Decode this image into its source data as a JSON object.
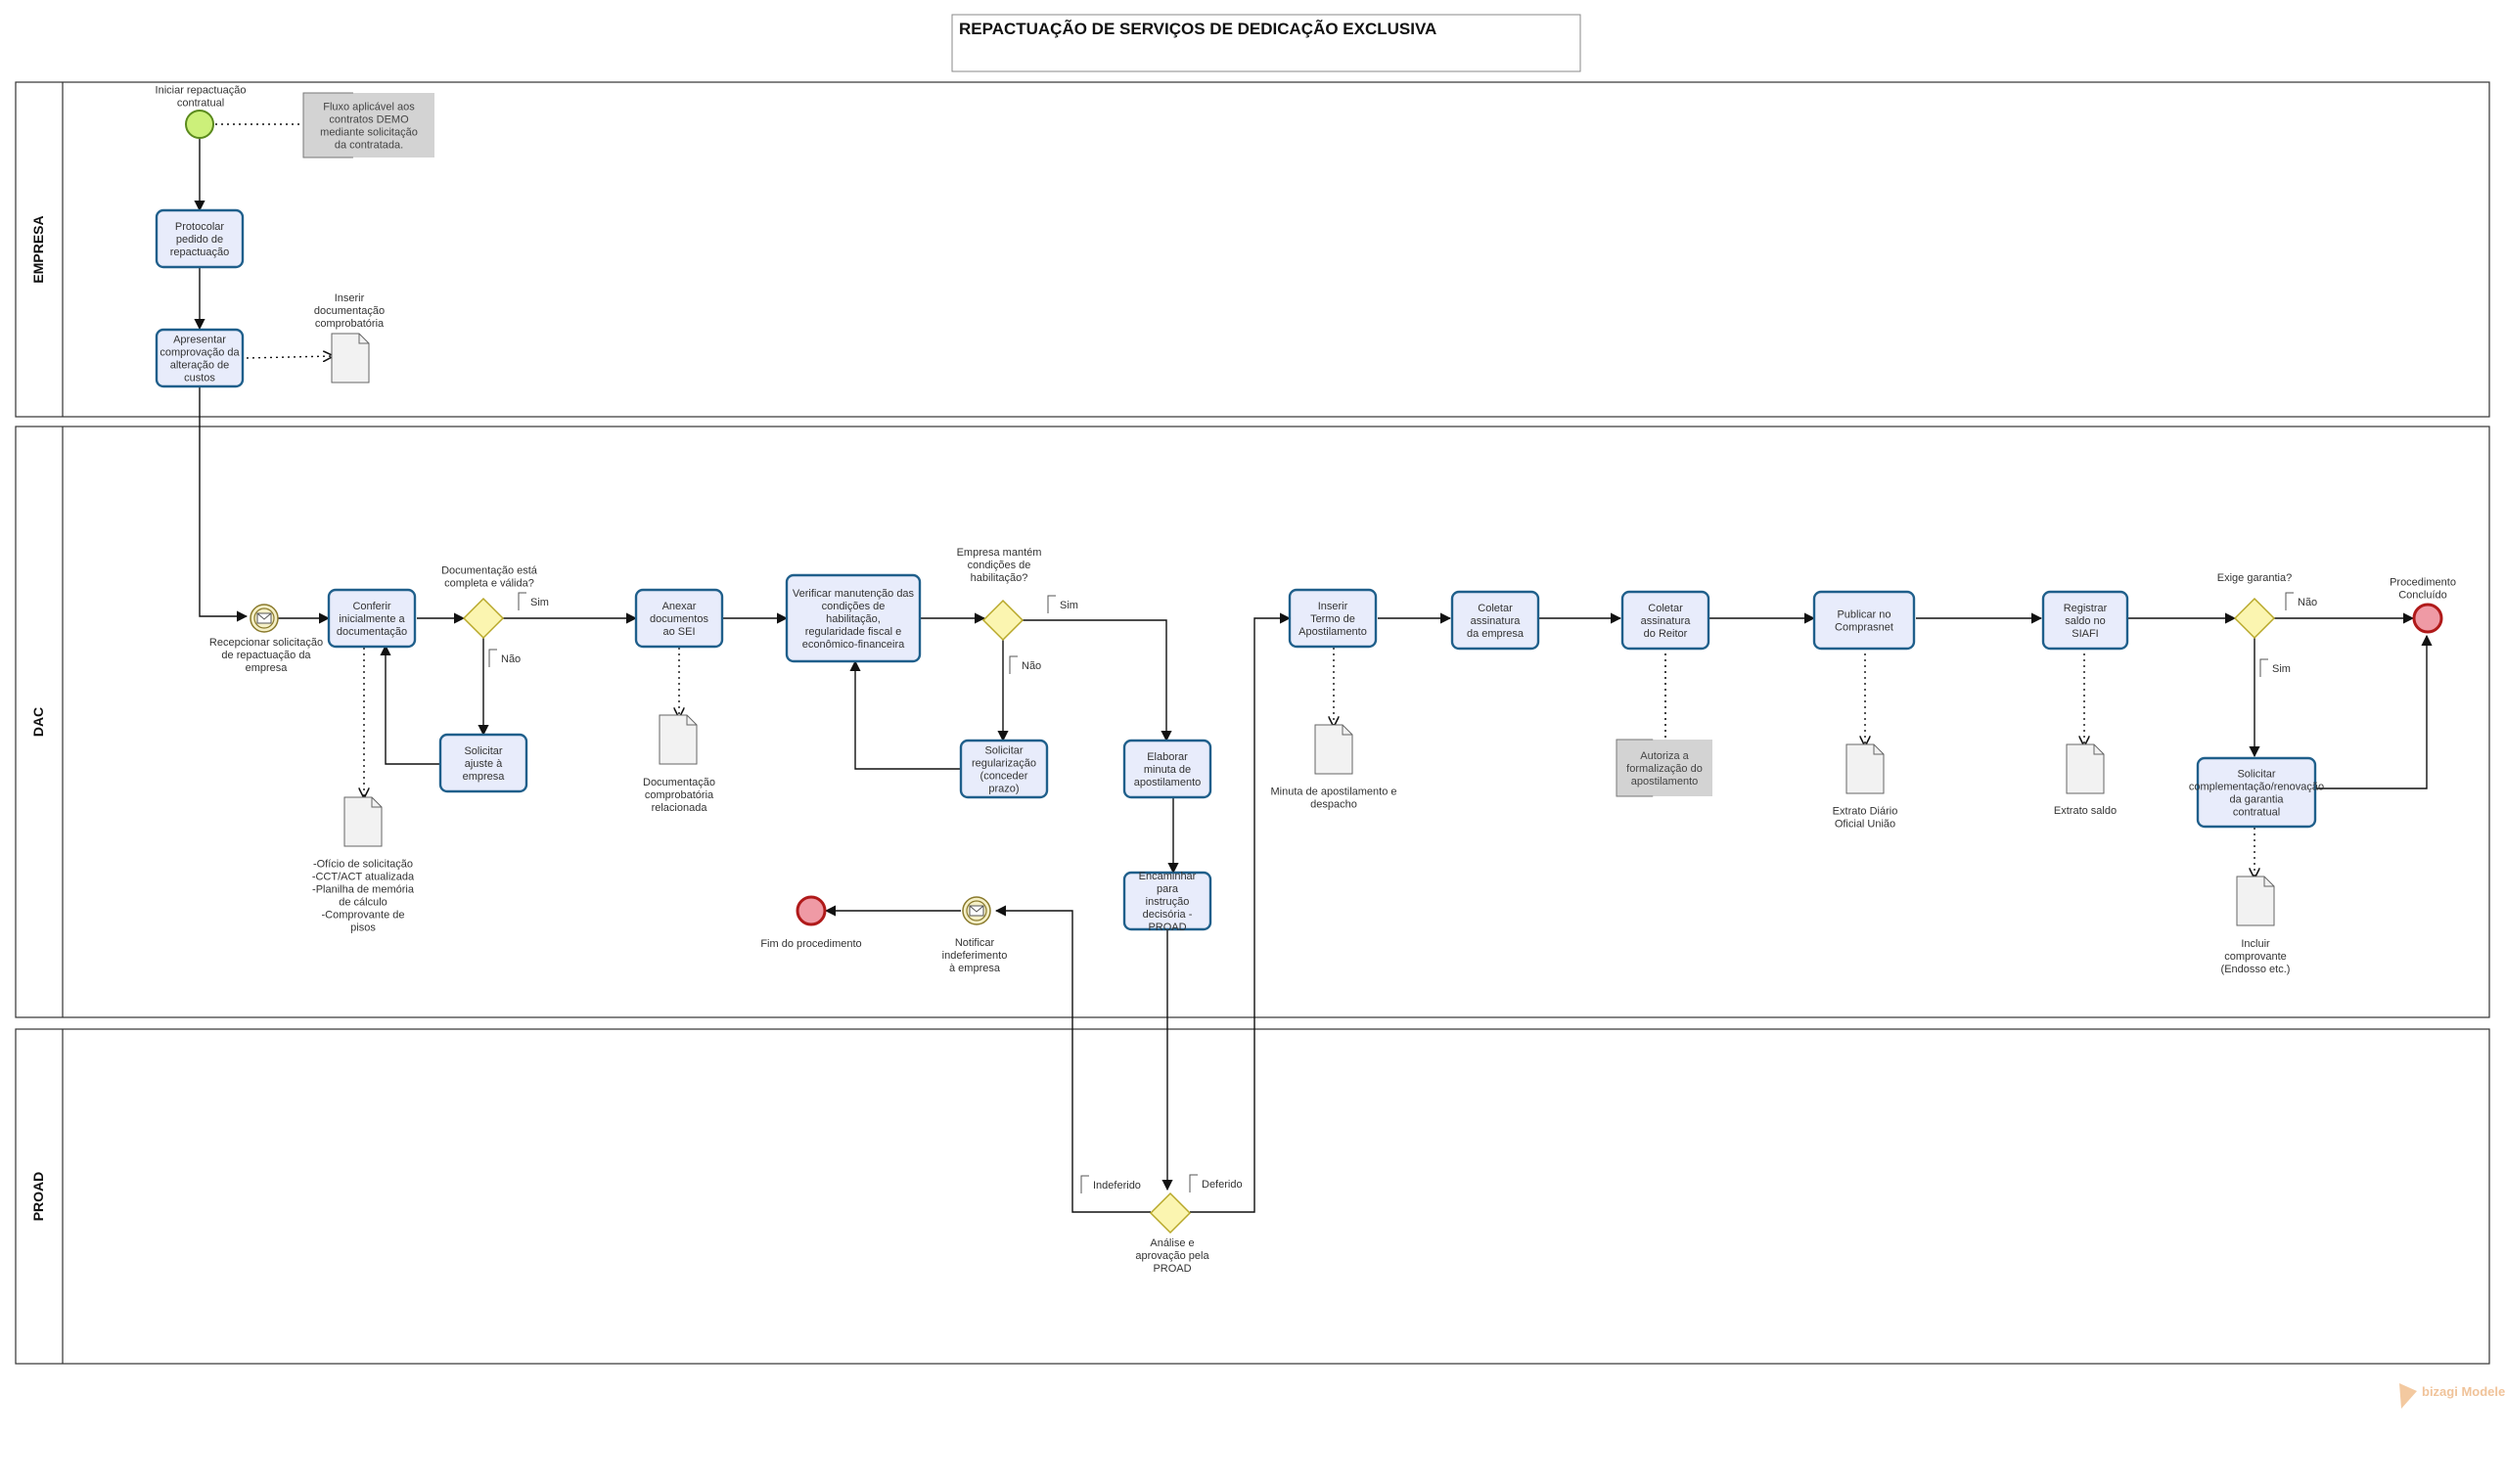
{
  "title": "REPACTUAÇÃO DE SERVIÇOS DE DEDICAÇÃO EXCLUSIVA",
  "lanes": {
    "empresa": "EMPRESA",
    "dac": "DAC",
    "proad": "PROAD"
  },
  "events": {
    "start": "Iniciar repactuação contratual",
    "receive_message": "Recepcionar solicitação de repactuação da empresa",
    "notify_rejection": "Notificar indeferimento à empresa",
    "end_rejected": "Fim do procedimento",
    "end_completed": "Procedimento Concluído"
  },
  "tasks": {
    "protocolar": "Protocolar pedido de repactuação",
    "apresentar": "Apresentar comprovação da alteração de custos",
    "conferir": "Conferir inicialmente a documentação",
    "solicitar_ajuste": "Solicitar ajuste à empresa",
    "anexar": "Anexar documentos ao SEI",
    "verificar": "Verificar manutenção das condições de habilitação, regularidade fiscal e econômico-financeira",
    "solicitar_regularizacao": "Solicitar regularização (conceder prazo)",
    "elaborar": "Elaborar minuta de apostilamento",
    "encaminhar": "Encaminhar para instrução decisória - PROAD",
    "inserir": "Inserir Termo de Apostilamento",
    "coletar_empresa": "Coletar assinatura da empresa",
    "coletar_reitor": "Coletar assinatura do Reitor",
    "publicar": "Publicar no Comprasnet",
    "registrar": "Registrar saldo no SIAFI",
    "solicitar_garantia": "Solicitar complementação/renovação da garantia contratual"
  },
  "gateways": {
    "doc_valida": "Documentação está completa e válida?",
    "habilitacao": "Empresa mantém condições de habilitação?",
    "analise": "Análise e aprovação pela PROAD",
    "garantia": "Exige garantia?"
  },
  "flow_labels": {
    "sim": "Sim",
    "nao": "Não",
    "deferido": "Deferido",
    "indeferido": "Indeferido"
  },
  "annotations": {
    "fluxo": "Fluxo aplicável aos contratos DEMO mediante solicitação da contratada.",
    "autoriza": "Autoriza a formalização do apostilamento"
  },
  "artifacts": {
    "inserir_doc": "Inserir documentação comprobatória",
    "oficio": [
      "-Ofício de solicitação",
      "-CCT/ACT atualizada",
      "-Planilha de memória",
      "de cálculo",
      "-Comprovante de",
      "pisos"
    ],
    "doc_relacionada": "Documentação comprobatória relacionada",
    "minuta": "Minuta de apostilamento e despacho",
    "extrato_diario": "Extrato Diário Oficial União",
    "extrato_saldo": "Extrato saldo",
    "comprovante": "Incluir comprovante (Endosso etc.)"
  },
  "watermark": "bizagi Modeler"
}
